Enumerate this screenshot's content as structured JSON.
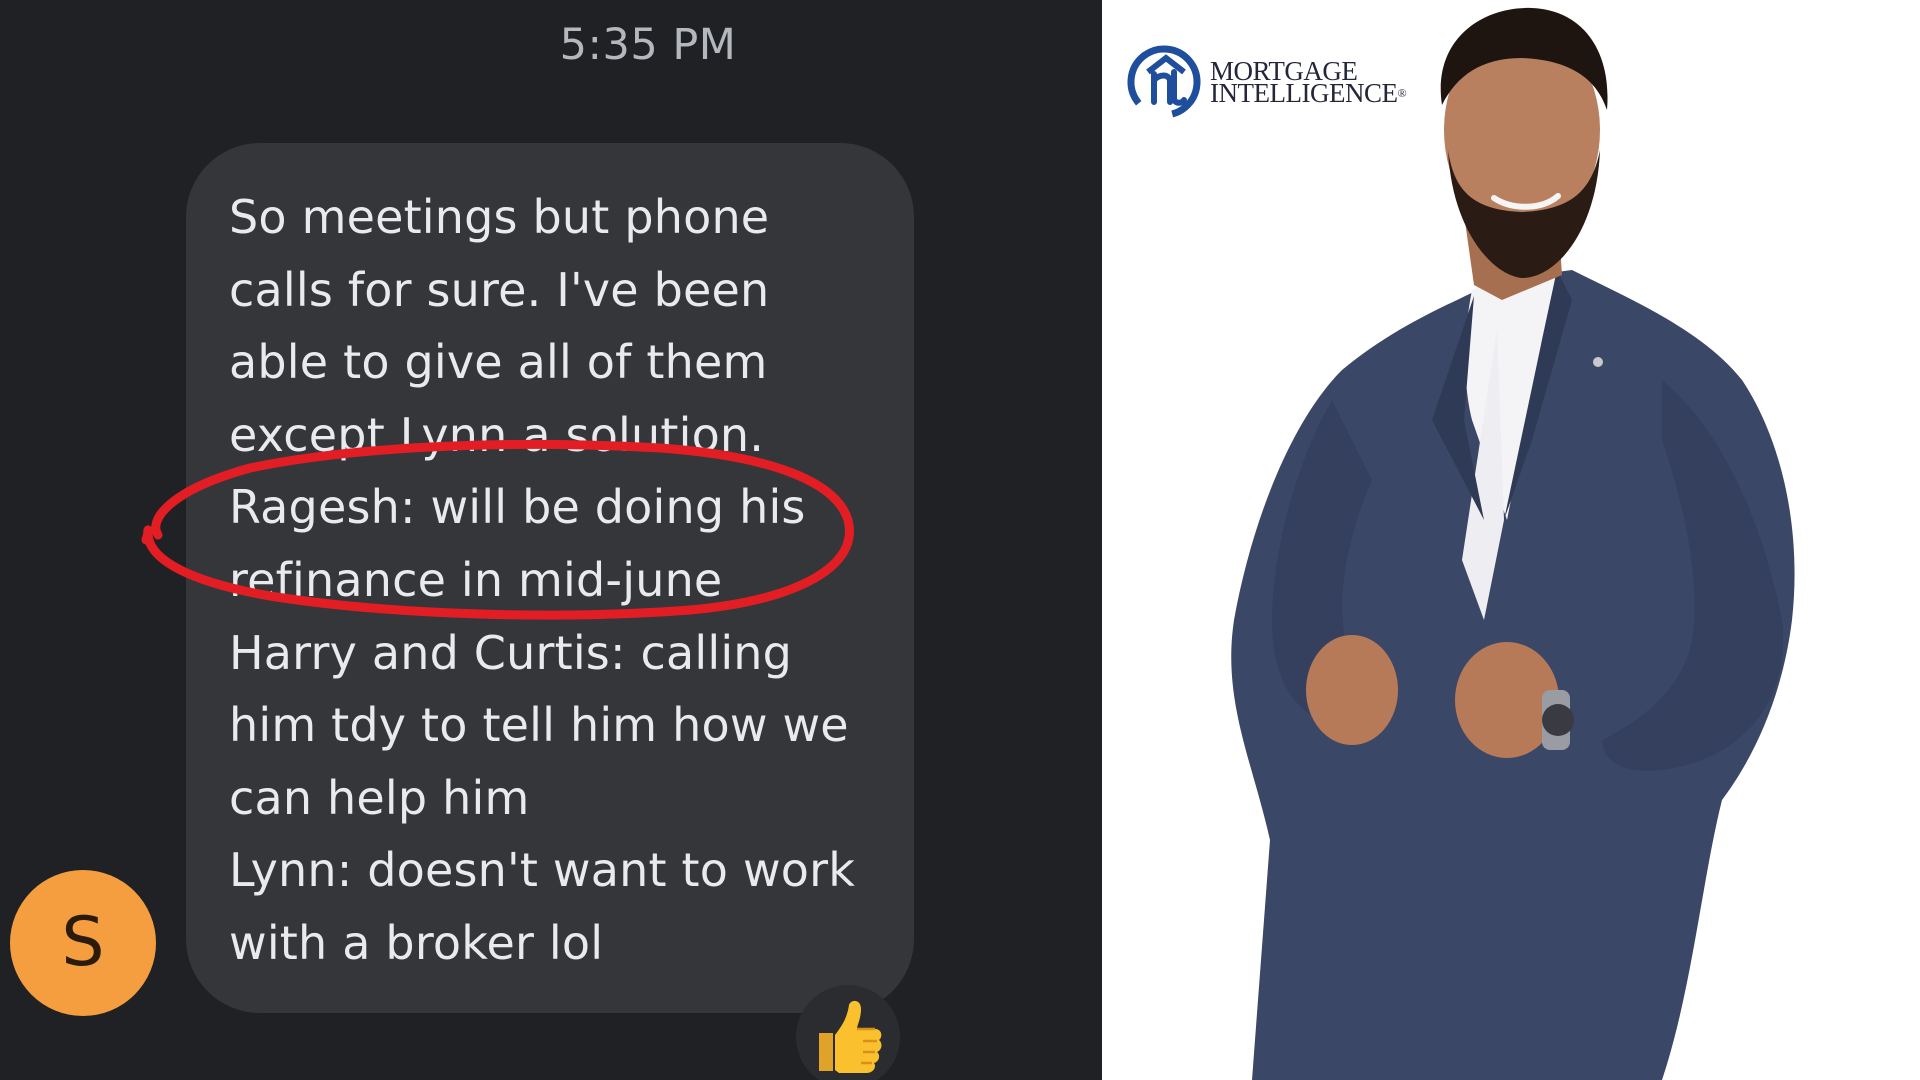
{
  "chat": {
    "timestamp": "5:35 PM",
    "message": "So meetings but phone\ncalls for sure. I've been\nable to give all of them\nexcept Lynn a solution.\nRagesh: will be doing his\nrefinance in mid-june\nHarry and Curtis: calling\nhim tdy to tell him how we\ncan help him\nLynn: doesn't want to work\nwith a broker lol",
    "sender_initial": "S",
    "reaction": "👍",
    "annotation_color": "#e21e24",
    "avatar_color": "#f59e3f",
    "bubble_color": "#35363a",
    "background_color": "#202124"
  },
  "promo": {
    "logo_line1": "MORTGAGE",
    "logo_line2": "INTELLIGENCE",
    "logo_trademark": "®",
    "logo_color": "#1f4e9c"
  }
}
